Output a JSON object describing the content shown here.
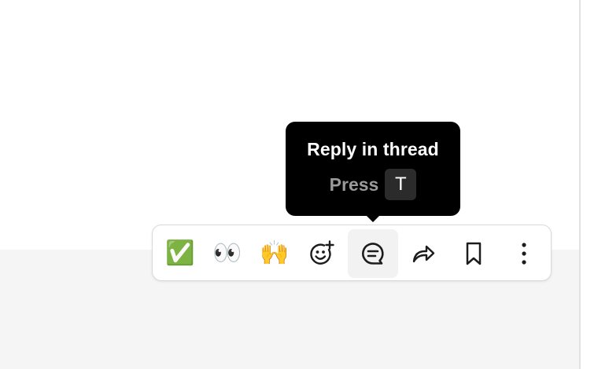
{
  "tooltip": {
    "title": "Reply in thread",
    "hint_label": "Press",
    "shortcut_key": "T"
  },
  "toolbar": {
    "reactions": [
      {
        "name": "white-check-mark",
        "glyph": "✅"
      },
      {
        "name": "eyes",
        "glyph": "👀"
      },
      {
        "name": "raised-hands",
        "glyph": "🙌"
      }
    ],
    "actions": [
      {
        "name": "add-reaction",
        "icon": "smiley-plus-icon"
      },
      {
        "name": "reply-in-thread",
        "icon": "thread-bubble-icon",
        "active": true
      },
      {
        "name": "forward-message",
        "icon": "share-arrow-icon"
      },
      {
        "name": "save-for-later",
        "icon": "bookmark-icon"
      },
      {
        "name": "more-actions",
        "icon": "vertical-ellipsis-icon"
      }
    ]
  },
  "colors": {
    "tooltip_bg": "#000000",
    "hint_text": "#9a9a9a",
    "key_bg": "#2b2b2b",
    "icon_stroke": "#1d1c1d",
    "active_button_bg": "#f2f2f2",
    "panel_bg": "#f5f5f5",
    "toolbar_border": "#d9d9d9"
  }
}
